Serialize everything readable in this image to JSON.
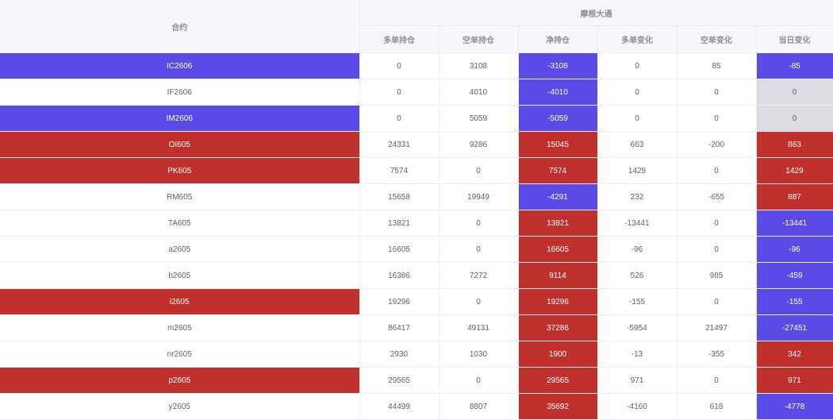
{
  "colors": {
    "red": "#c0302c",
    "blue": "#5a4ae6",
    "gray": "#dcdbe1"
  },
  "header": {
    "contract": "合约",
    "group": "摩根大通",
    "columns": [
      "多单持仓",
      "空单持仓",
      "净持仓",
      "多单变化",
      "空单变化",
      "当日变化"
    ]
  },
  "rows": [
    {
      "contract": "IC2606",
      "contract_color": "blue",
      "values": [
        "0",
        "3108",
        "-3108",
        "0",
        "85",
        "-85"
      ],
      "net_color": "blue",
      "daily_color": "blue"
    },
    {
      "contract": "IF2606",
      "contract_color": "none",
      "values": [
        "0",
        "4010",
        "-4010",
        "0",
        "0",
        "0"
      ],
      "net_color": "blue",
      "daily_color": "gray"
    },
    {
      "contract": "IM2606",
      "contract_color": "blue",
      "values": [
        "0",
        "5059",
        "-5059",
        "0",
        "0",
        "0"
      ],
      "net_color": "blue",
      "daily_color": "gray"
    },
    {
      "contract": "OI605",
      "contract_color": "red",
      "values": [
        "24331",
        "9286",
        "15045",
        "663",
        "-200",
        "863"
      ],
      "net_color": "red",
      "daily_color": "red"
    },
    {
      "contract": "PK605",
      "contract_color": "red",
      "values": [
        "7574",
        "0",
        "7574",
        "1429",
        "0",
        "1429"
      ],
      "net_color": "red",
      "daily_color": "red"
    },
    {
      "contract": "RM605",
      "contract_color": "none",
      "values": [
        "15658",
        "19949",
        "-4291",
        "232",
        "-655",
        "887"
      ],
      "net_color": "blue",
      "daily_color": "red"
    },
    {
      "contract": "TA605",
      "contract_color": "none",
      "values": [
        "13821",
        "0",
        "13821",
        "-13441",
        "0",
        "-13441"
      ],
      "net_color": "red",
      "daily_color": "blue"
    },
    {
      "contract": "a2605",
      "contract_color": "none",
      "values": [
        "16605",
        "0",
        "16605",
        "-96",
        "0",
        "-96"
      ],
      "net_color": "red",
      "daily_color": "blue"
    },
    {
      "contract": "b2605",
      "contract_color": "none",
      "values": [
        "16386",
        "7272",
        "9114",
        "526",
        "985",
        "-459"
      ],
      "net_color": "red",
      "daily_color": "blue"
    },
    {
      "contract": "i2605",
      "contract_color": "red",
      "values": [
        "19296",
        "0",
        "19296",
        "-155",
        "0",
        "-155"
      ],
      "net_color": "red",
      "daily_color": "blue"
    },
    {
      "contract": "m2605",
      "contract_color": "none",
      "values": [
        "86417",
        "49131",
        "37286",
        "-5954",
        "21497",
        "-27451"
      ],
      "net_color": "red",
      "daily_color": "blue"
    },
    {
      "contract": "nr2605",
      "contract_color": "none",
      "values": [
        "2930",
        "1030",
        "1900",
        "-13",
        "-355",
        "342"
      ],
      "net_color": "red",
      "daily_color": "red"
    },
    {
      "contract": "p2605",
      "contract_color": "red",
      "values": [
        "29565",
        "0",
        "29565",
        "971",
        "0",
        "971"
      ],
      "net_color": "red",
      "daily_color": "red"
    },
    {
      "contract": "y2605",
      "contract_color": "none",
      "values": [
        "44499",
        "8807",
        "35692",
        "-4160",
        "618",
        "-4778"
      ],
      "net_color": "red",
      "daily_color": "blue"
    }
  ]
}
